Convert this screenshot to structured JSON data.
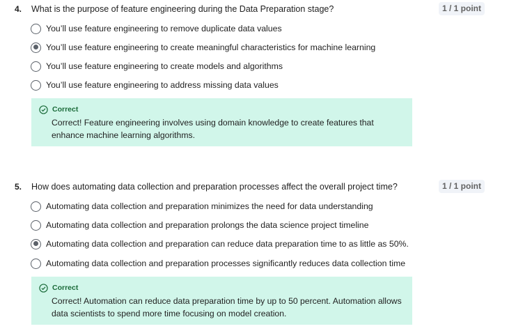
{
  "questions": [
    {
      "number": "4.",
      "text": "What is the purpose of feature engineering during the Data Preparation stage?",
      "score": "1 / 1 point",
      "options": [
        {
          "label": "You’ll use feature engineering to remove duplicate data values",
          "selected": false
        },
        {
          "label": "You’ll use feature engineering to create meaningful characteristics for machine learning",
          "selected": true
        },
        {
          "label": "You’ll use feature engineering to create models and algorithms",
          "selected": false
        },
        {
          "label": "You’ll use feature engineering to address missing data values",
          "selected": false
        }
      ],
      "feedback": {
        "title": "Correct",
        "icon": "check-circle-icon",
        "body": "Correct! Feature engineering involves using domain knowledge to create features that enhance machine learning algorithms."
      }
    },
    {
      "number": "5.",
      "text": "How does automating data collection and preparation processes affect the overall project time?",
      "score": "1 / 1 point",
      "options": [
        {
          "label": "Automating data collection and preparation minimizes the need for data understanding",
          "selected": false
        },
        {
          "label": "Automating data collection and preparation prolongs the data science project timeline",
          "selected": false
        },
        {
          "label": "Automating data collection and preparation can reduce data preparation time to as little as 50%.",
          "selected": true
        },
        {
          "label": "Automating data collection and preparation processes significantly reduces data collection time",
          "selected": false
        }
      ],
      "feedback": {
        "title": "Correct",
        "icon": "check-circle-icon",
        "body": "Correct! Automation can reduce data preparation time by up to 50 percent. Automation allows data scientists to spend more time focusing on model creation."
      }
    }
  ],
  "colors": {
    "feedback_bg": "#d1f6ea",
    "feedback_title": "#1b6b3a",
    "score_bg": "#f0f3f8"
  }
}
